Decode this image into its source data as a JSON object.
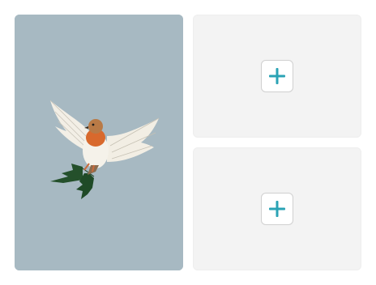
{
  "photo": {
    "subject_icon": "robin-with-holly-illustration",
    "background_color": "#a7b9c2"
  },
  "slots": [
    {
      "action_icon": "plus-icon",
      "accent_color": "#2aa3b5"
    },
    {
      "action_icon": "plus-icon",
      "accent_color": "#2aa3b5"
    }
  ]
}
